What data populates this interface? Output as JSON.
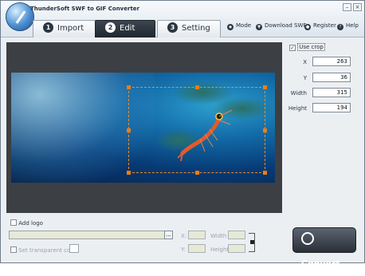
{
  "window": {
    "title": "ThunderSoft SWF to GIF Converter"
  },
  "tabs": [
    {
      "num": "1",
      "label": "Import"
    },
    {
      "num": "2",
      "label": "Edit"
    },
    {
      "num": "3",
      "label": "Setting"
    }
  ],
  "toplinks": {
    "mode": "Mode",
    "download": "Download SWF",
    "register": "Register",
    "help": "Help"
  },
  "crop": {
    "use_crop_label": "Use crop",
    "use_crop_checked": true,
    "x_label": "X",
    "x": "263",
    "y_label": "Y",
    "y": "36",
    "width_label": "Width",
    "width": "315",
    "height_label": "Height",
    "height": "194"
  },
  "logo": {
    "add_logo_label": "Add logo",
    "browse_label": "...",
    "transparent_label": "Set transparent color",
    "x_label": "X:",
    "y_label": "Y:",
    "width_label": "Width",
    "height_label": "Height"
  },
  "convert_label": "Convert"
}
